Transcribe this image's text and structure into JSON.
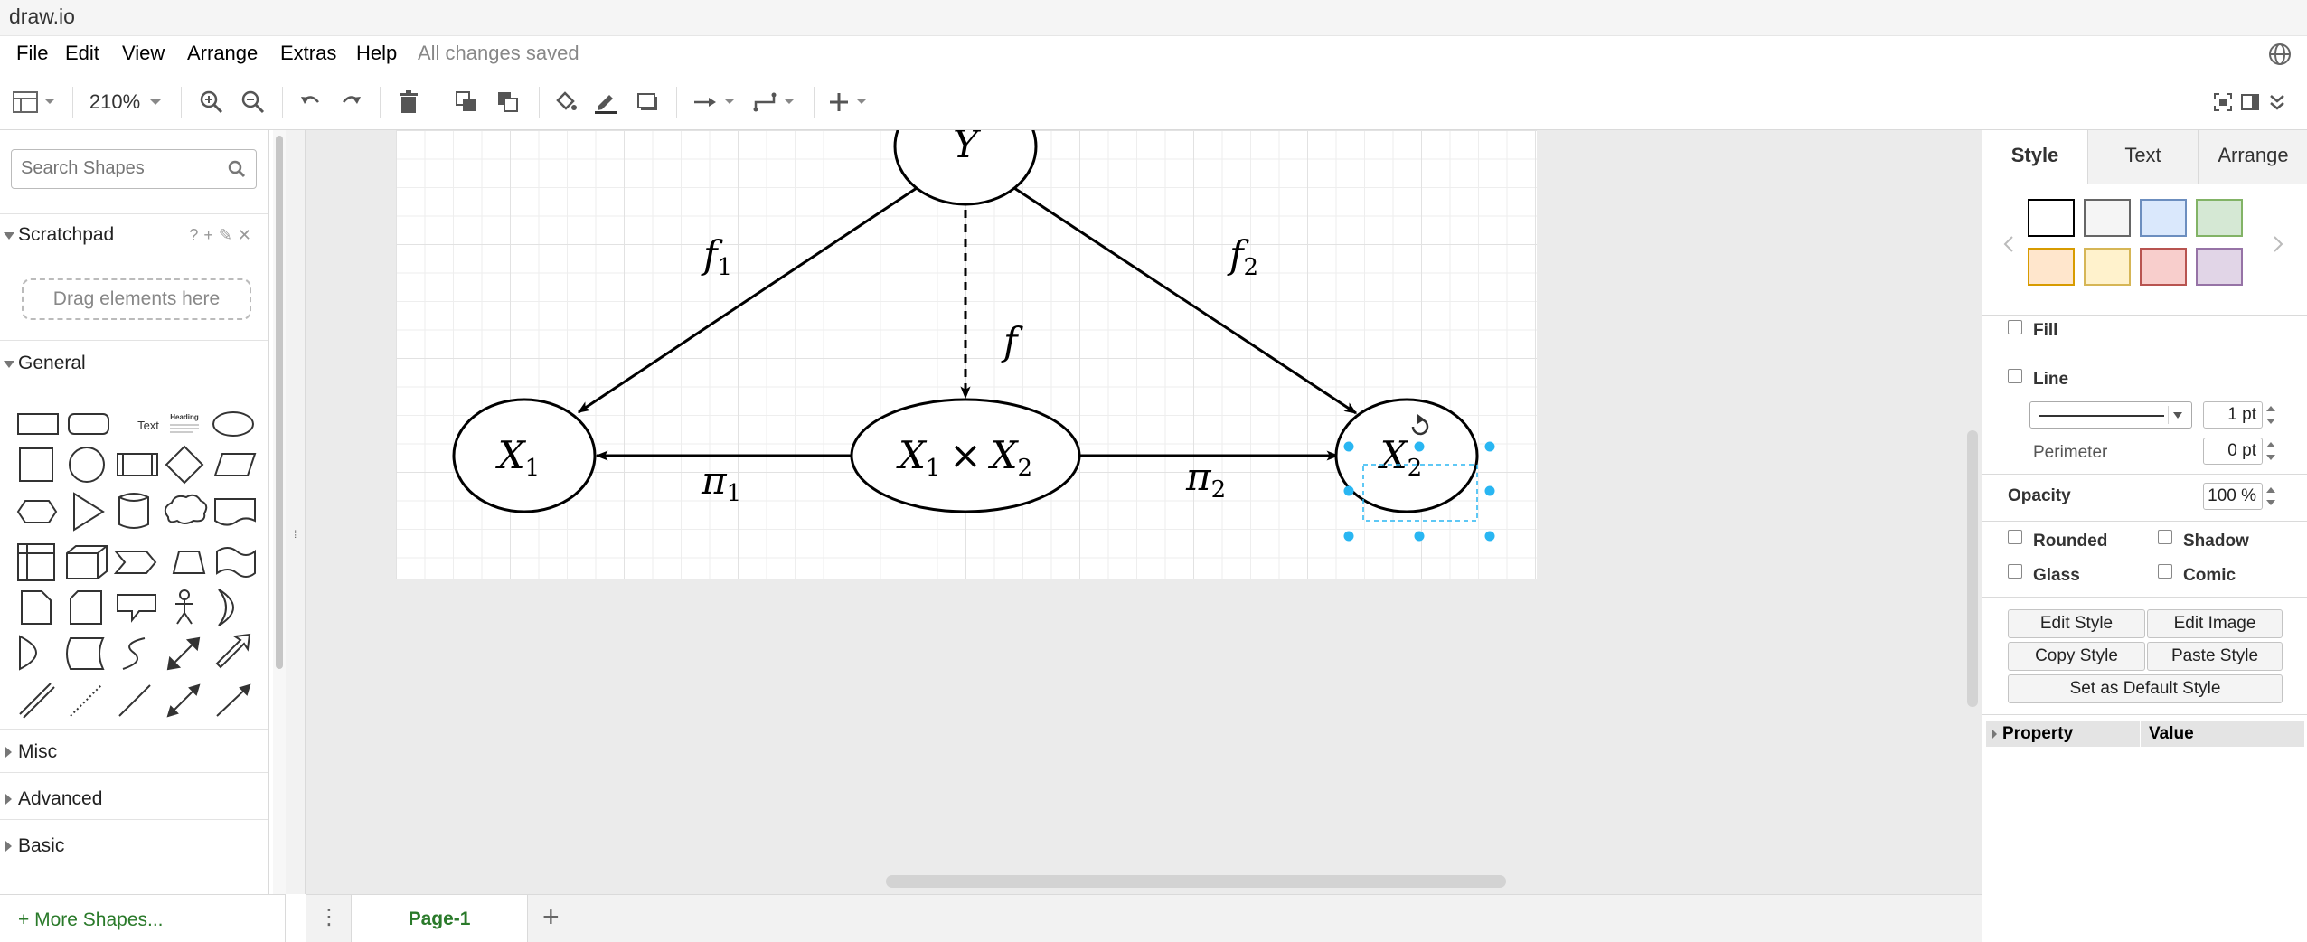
{
  "app": {
    "title": "draw.io"
  },
  "menu": {
    "items": [
      "File",
      "Edit",
      "View",
      "Arrange",
      "Extras",
      "Help"
    ],
    "status": "All changes saved"
  },
  "toolbar": {
    "zoom": "210%"
  },
  "sidebar": {
    "search_placeholder": "Search Shapes",
    "scratchpad": {
      "label": "Scratchpad",
      "icons": "?+✎✕",
      "drop_text": "Drag elements here"
    },
    "general": {
      "label": "General",
      "shape_labels": {
        "text": "Text",
        "heading": "Heading"
      }
    },
    "collapsed_sections": [
      "Misc",
      "Advanced",
      "Basic"
    ],
    "more_shapes": "+ More Shapes..."
  },
  "pages": {
    "tabs": [
      "Page-1"
    ]
  },
  "diagram": {
    "nodes": {
      "y": {
        "base": "Y",
        "sub": ""
      },
      "x1": {
        "base": "X",
        "sub": "1"
      },
      "x1x2": {
        "left": "X",
        "left_sub": "1",
        "op": "×",
        "right": "X",
        "right_sub": "2"
      },
      "x2": {
        "base": "X",
        "sub": "2"
      }
    },
    "edges": {
      "f1": {
        "base": "f",
        "sub": "1"
      },
      "f2": {
        "base": "f",
        "sub": "2"
      },
      "f": {
        "base": "f",
        "sub": ""
      },
      "pi1": {
        "base": "π",
        "sub": "1"
      },
      "pi2": {
        "base": "π",
        "sub": "2"
      }
    },
    "selected": "x2"
  },
  "format_panel": {
    "tabs": [
      "Style",
      "Text",
      "Arrange"
    ],
    "active_tab": "Style",
    "swatches": [
      {
        "fill": "#ffffff",
        "stroke": "#000000"
      },
      {
        "fill": "#f5f5f5",
        "stroke": "#666666"
      },
      {
        "fill": "#dae8fc",
        "stroke": "#6c8ebf"
      },
      {
        "fill": "#d5e8d4",
        "stroke": "#82b366"
      },
      {
        "fill": "#ffe6cc",
        "stroke": "#d79b00"
      },
      {
        "fill": "#fff2cc",
        "stroke": "#d6b656"
      },
      {
        "fill": "#f8cecc",
        "stroke": "#b85450"
      },
      {
        "fill": "#e1d5e7",
        "stroke": "#9673a6"
      }
    ],
    "fill_label": "Fill",
    "line_label": "Line",
    "line_width": "1 pt",
    "perimeter_label": "Perimeter",
    "perimeter_value": "0 pt",
    "opacity_label": "Opacity",
    "opacity_value": "100 %",
    "checkboxes": [
      "Rounded",
      "Shadow",
      "Glass",
      "Comic"
    ],
    "buttons": {
      "edit_style": "Edit Style",
      "edit_image": "Edit Image",
      "copy_style": "Copy Style",
      "paste_style": "Paste Style",
      "set_default": "Set as Default Style"
    },
    "table_headers": [
      "Property",
      "Value"
    ]
  }
}
